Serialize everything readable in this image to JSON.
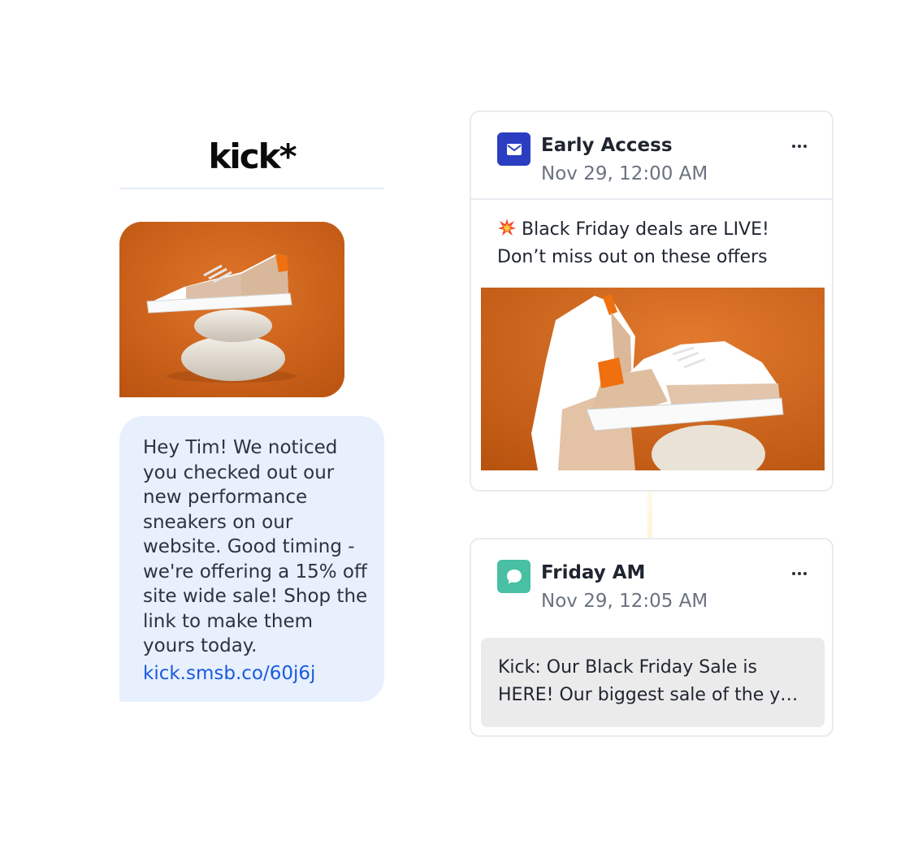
{
  "brand": {
    "logo_text": "kick*"
  },
  "sms": {
    "image_alt": "sneaker-on-stones-photo",
    "message": "Hey Tim! We noticed you checked out our new performance sneakers on our website. Good timing - we're offering a 15% off site wide sale! Shop the link to make them yours today.",
    "link": "kick.smsb.co/60j6j"
  },
  "cards": [
    {
      "icon": "email-icon",
      "title": "Early Access",
      "timestamp": "Nov 29, 12:00 AM",
      "message_icon": "collision-icon",
      "message_line1": "Black Friday deals are LIVE!",
      "message_line2": "Don’t miss out on these offers",
      "image": "sneaker-pair-photo"
    },
    {
      "icon": "chat-bubble-icon",
      "title": "Friday AM",
      "timestamp": "Nov 29, 12:05 AM",
      "preview_line1": "Kick: Our Black Friday Sale is",
      "preview_line2": "HERE! Our biggest sale of the y…"
    }
  ],
  "colors": {
    "email_icon_bg": "#2b3ec2",
    "sms_icon_bg": "#49bfa3",
    "sms_bubble_bg": "#e8f0fd",
    "link": "#1a5adf",
    "photo_background": "#d1631a"
  }
}
